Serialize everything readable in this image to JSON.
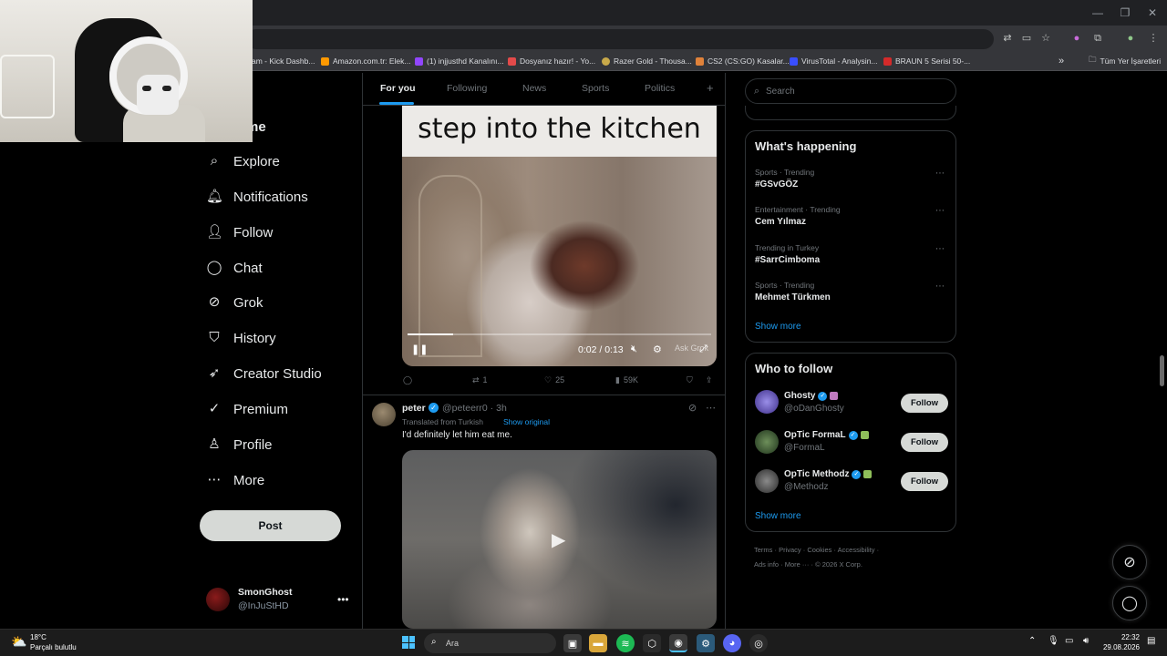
{
  "browser": {
    "bookmarks": [
      {
        "label": "am - Kick Dashb...",
        "color": "#53fc18"
      },
      {
        "label": "Amazon.com.tr: Elek...",
        "color": "#ff9900"
      },
      {
        "label": "(1) injjusthd Kanalını...",
        "color": "#9146ff"
      },
      {
        "label": "Dosyanız hazır! - Yo...",
        "color": "#e34a4a"
      },
      {
        "label": "Razer Gold - Thousa...",
        "color": "#c8a94a"
      },
      {
        "label": "CS2 (CS:GO) Kasalar...",
        "color": "#e0823a"
      },
      {
        "label": "VirusTotal - Analysin...",
        "color": "#394eff"
      },
      {
        "label": "BRAUN 5 Serisi 50-...",
        "color": "#d42a2a"
      }
    ],
    "all_bookmarks_label": "Tüm Yer İşaretleri"
  },
  "nav": {
    "home_partial": "me",
    "items": [
      {
        "label": "Explore",
        "icon": "search-icon",
        "glyph": "⌕"
      },
      {
        "label": "Notifications",
        "icon": "bell-icon",
        "glyph": "🔔︎"
      },
      {
        "label": "Follow",
        "icon": "person-plus-icon",
        "glyph": "👤︎"
      },
      {
        "label": "Chat",
        "icon": "chat-bubble-icon",
        "glyph": "◯"
      },
      {
        "label": "Grok",
        "icon": "grok-icon",
        "glyph": "⊘"
      },
      {
        "label": "History",
        "icon": "bookmark-icon",
        "glyph": "⛉"
      },
      {
        "label": "Creator Studio",
        "icon": "rocket-icon",
        "glyph": "➶"
      },
      {
        "label": "Premium",
        "icon": "verified-check-icon",
        "glyph": "✓"
      },
      {
        "label": "Profile",
        "icon": "person-icon",
        "glyph": "♙"
      },
      {
        "label": "More",
        "icon": "more-circle-icon",
        "glyph": "⋯"
      }
    ],
    "post_label": "Post"
  },
  "account": {
    "name": "SmonGhost",
    "handle": "@InJuStHD"
  },
  "feed": {
    "tabs": [
      {
        "label": "For you",
        "active": true
      },
      {
        "label": "Following",
        "active": false
      },
      {
        "label": "News",
        "active": false
      },
      {
        "label": "Sports",
        "active": false
      },
      {
        "label": "Politics",
        "active": false
      }
    ],
    "add_tab_glyph": "+",
    "tweet1": {
      "video_caption": "step into the kitchen",
      "time": "0:02 / 0:13",
      "progress": 0.15,
      "replies": "",
      "reposts": "1",
      "likes": "25",
      "views": "59K",
      "watermark": "Ask Grok"
    },
    "tweet2": {
      "name": "peter",
      "handle_time": "@peteerr0 · 3h",
      "translated": "Translated from Turkish",
      "show_original": "Show original",
      "text": "I'd definitely let him eat me."
    }
  },
  "sidebar": {
    "search_placeholder": "Search",
    "happening_title": "What's happening",
    "trends": [
      {
        "meta": "Sports · Trending",
        "name": "#GSvGÖZ"
      },
      {
        "meta": "Entertainment · Trending",
        "name": "Cem Yılmaz"
      },
      {
        "meta": "Trending in Turkey",
        "name": "#SarrCimboma"
      },
      {
        "meta": "Sports · Trending",
        "name": "Mehmet Türkmen"
      }
    ],
    "show_more": "Show more",
    "wtf_title": "Who to follow",
    "wtf": [
      {
        "name": "Ghosty",
        "handle": "@oDanGhosty",
        "follow": "Follow",
        "avatar": "#6a5acd",
        "badge_color": "#c07ac0"
      },
      {
        "name": "OpTic FormaL",
        "handle": "@FormaL",
        "follow": "Follow",
        "avatar": "#2e4a2e",
        "badge_color": "#8fbf5a"
      },
      {
        "name": "OpTic Methodz",
        "handle": "@Methodz",
        "follow": "Follow",
        "avatar": "#3b3b3b",
        "badge_color": "#8fbf5a"
      }
    ],
    "footer_line1": "Terms  ·  Privacy  ·  Cookies  ·  Accessibility  ·",
    "footer_line2": "Ads info  ·  More ···  ·  © 2026 X Corp."
  },
  "taskbar": {
    "temp": "18°C",
    "condition": "Parçalı bulutlu",
    "search_placeholder": "Ara",
    "time": "22:32",
    "date": "29.08.2026"
  }
}
